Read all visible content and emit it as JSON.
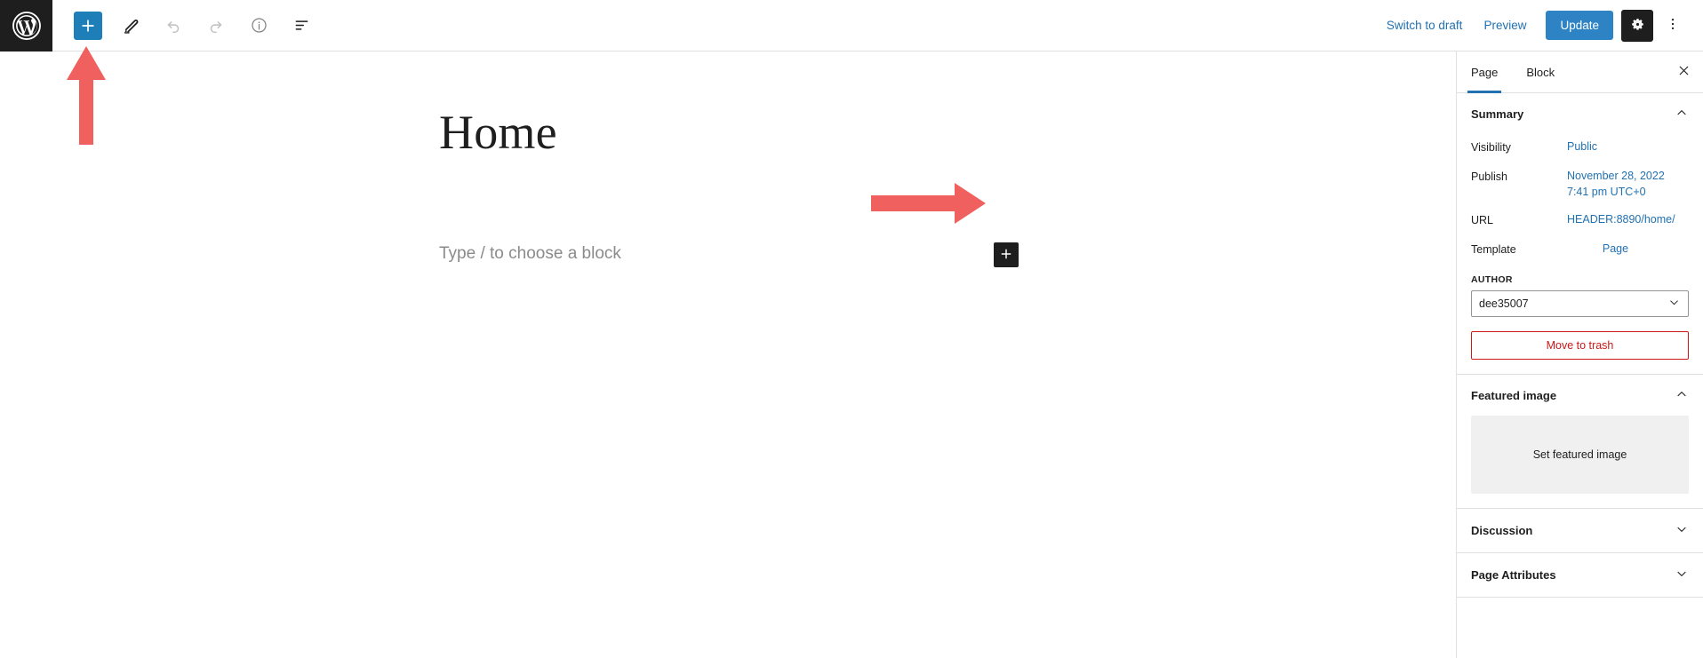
{
  "topbar": {
    "logo_icon": "wordpress-logo-icon",
    "inserter_label": "+",
    "inserter_icon": "plus-icon",
    "tools": [
      {
        "name": "edit-tool",
        "icon": "pencil-icon",
        "disabled": false
      },
      {
        "name": "undo",
        "icon": "undo-arrow-icon",
        "disabled": true
      },
      {
        "name": "redo",
        "icon": "redo-arrow-icon",
        "disabled": true
      },
      {
        "name": "details",
        "icon": "info-circle-icon",
        "disabled": false
      },
      {
        "name": "list-view",
        "icon": "list-view-icon",
        "disabled": false
      }
    ],
    "switch_to_draft": "Switch to draft",
    "preview": "Preview",
    "update": "Update",
    "settings_icon": "gear-icon",
    "more_icon": "three-dots-vertical-icon",
    "accent_blue": "#2d83c4",
    "inserter_blue": "#1e7eb8",
    "dark": "#1e1e1e"
  },
  "editor": {
    "post_title": "Home",
    "block_placeholder": "Type / to choose a block",
    "inline_inserter_icon": "plus-icon"
  },
  "annotations": {
    "arrow_color": "#f0605e",
    "arrow_up_name": "annotation-arrow-up-to-inserter",
    "arrow_right_name": "annotation-arrow-right-to-block-inserter"
  },
  "sidebar": {
    "tabs": [
      {
        "label": "Page",
        "active": true
      },
      {
        "label": "Block",
        "active": false
      }
    ],
    "close_icon": "close-x-icon",
    "panels": [
      {
        "id": "summary",
        "title": "Summary",
        "expanded": true,
        "chevron": "chevron-up-icon",
        "rows": [
          {
            "label": "Visibility",
            "value": "Public"
          },
          {
            "label": "Publish",
            "value": "November 28, 2022 7:41 pm UTC+0"
          },
          {
            "label": "URL",
            "value": "HEADER:8890/home/"
          },
          {
            "label": "Template",
            "value": "Page"
          }
        ],
        "author_field_label": "AUTHOR",
        "author_value": "dee35007",
        "author_chevron": "chevron-down-icon",
        "trash_label": "Move to trash",
        "trash_color": "#cc1818"
      },
      {
        "id": "featured-image",
        "title": "Featured image",
        "expanded": true,
        "chevron": "chevron-up-icon",
        "set_featured_label": "Set featured image"
      },
      {
        "id": "discussion",
        "title": "Discussion",
        "expanded": false,
        "chevron": "chevron-down-icon"
      },
      {
        "id": "page-attributes",
        "title": "Page Attributes",
        "expanded": false,
        "chevron": "chevron-down-icon"
      }
    ]
  }
}
